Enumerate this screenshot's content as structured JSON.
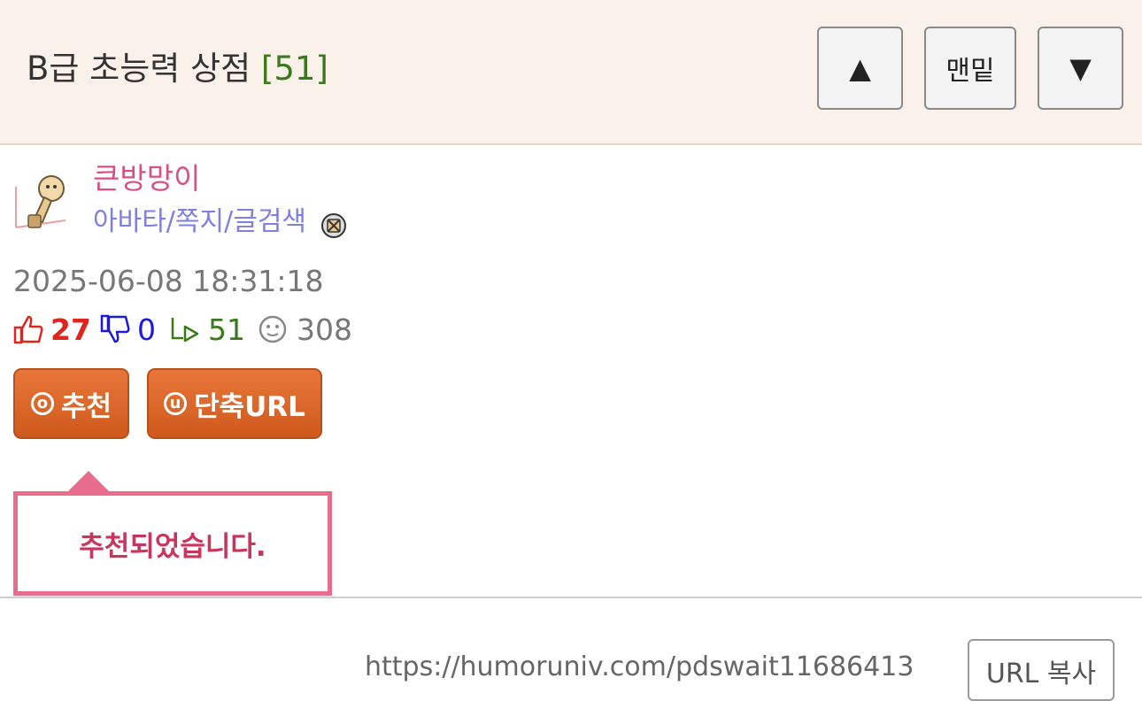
{
  "header": {
    "title": "B급 초능력 상점",
    "reply_count": "[51]",
    "up_label": "▲",
    "bottom_label": "맨밑",
    "down_label": "▼"
  },
  "author": {
    "nickname": "큰방망이",
    "links": "아바타/쪽지/글검색",
    "icons": [
      "avatar",
      "block-icon"
    ]
  },
  "post": {
    "datetime": "2025-06-08 18:31:18",
    "stats": {
      "recommend": "27",
      "oppose": "0",
      "replies": "51",
      "views": "308"
    }
  },
  "actions": {
    "recommend_icon": "ⓞ",
    "recommend_label": "추천",
    "short_url_icon": "ⓤ",
    "short_url_label": "단축URL"
  },
  "tooltip": {
    "message": "추천되었습니다."
  },
  "url_bar": {
    "url": "https://humoruniv.com/pdswait11686413",
    "copy_label": "URL 복사"
  },
  "colors": {
    "header_bg": "#faf2ea",
    "reply_count": "#3a7a1c",
    "nickname": "#d94f88",
    "links": "#7d7ee6",
    "recommend": "#e0261c",
    "oppose": "#1a1adb",
    "button": "#d96326",
    "tooltip_border": "#e86c8c"
  }
}
